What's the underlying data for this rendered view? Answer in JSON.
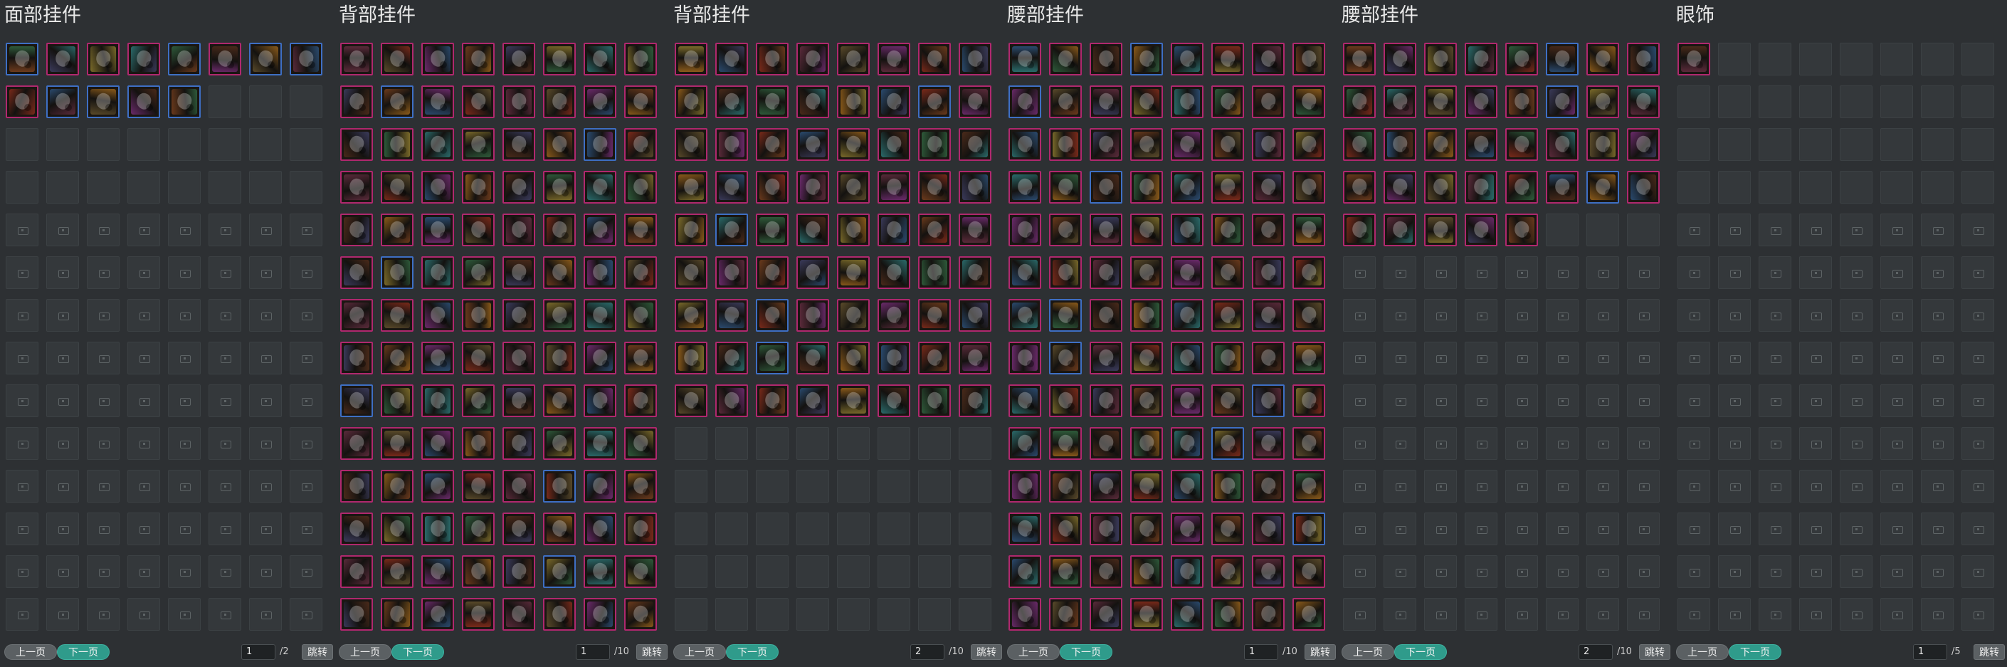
{
  "colors": {
    "background": "#2d3033",
    "rare_border": "#b0286e",
    "uncommon_border": "#3e6fc4",
    "next_button": "#2f9b8b",
    "prev_button": "#5b6063"
  },
  "grid": {
    "columns": 8,
    "rows": 14
  },
  "pager_labels": {
    "prev": "上一页",
    "next": "下一页",
    "jump": "跳转"
  },
  "panels": [
    {
      "id": "face",
      "title": "面部挂件",
      "filled": 13,
      "unlocked_slots": 32,
      "blue_items": [
        0,
        4,
        6,
        7,
        9,
        10,
        11,
        12
      ],
      "current_page": "1",
      "total_pages": "/2"
    },
    {
      "id": "back-1",
      "title": "背部挂件",
      "filled": 112,
      "unlocked_slots": 112,
      "blue_items": [
        9,
        22,
        41,
        64,
        85,
        101
      ],
      "current_page": "1",
      "total_pages": "/10"
    },
    {
      "id": "back-2",
      "title": "背部挂件",
      "filled": 72,
      "unlocked_slots": 112,
      "blue_items": [
        14,
        33,
        50,
        58
      ],
      "current_page": "2",
      "total_pages": "/10"
    },
    {
      "id": "waist-1",
      "title": "腰部挂件",
      "filled": 112,
      "unlocked_slots": 112,
      "blue_items": [
        3,
        8,
        26,
        49,
        57,
        70,
        77,
        95
      ],
      "current_page": "1",
      "total_pages": "/10"
    },
    {
      "id": "waist-2",
      "title": "腰部挂件",
      "filled": 37,
      "unlocked_slots": 40,
      "blue_items": [
        5,
        13,
        30
      ],
      "current_page": "2",
      "total_pages": "/10"
    },
    {
      "id": "glasses",
      "title": "眼饰",
      "filled": 1,
      "unlocked_slots": 32,
      "blue_items": [],
      "current_page": "1",
      "total_pages": "/5"
    }
  ],
  "icon_palette": [
    "#6b3a1c",
    "#2a4a6e",
    "#7a6a2a",
    "#5a2a3a",
    "#2e5a3a",
    "#6a2a6a",
    "#8a5a1a",
    "#3a3a5a",
    "#7a2a1a",
    "#2a6a6a",
    "#5a4a2a",
    "#4a2a1a"
  ]
}
